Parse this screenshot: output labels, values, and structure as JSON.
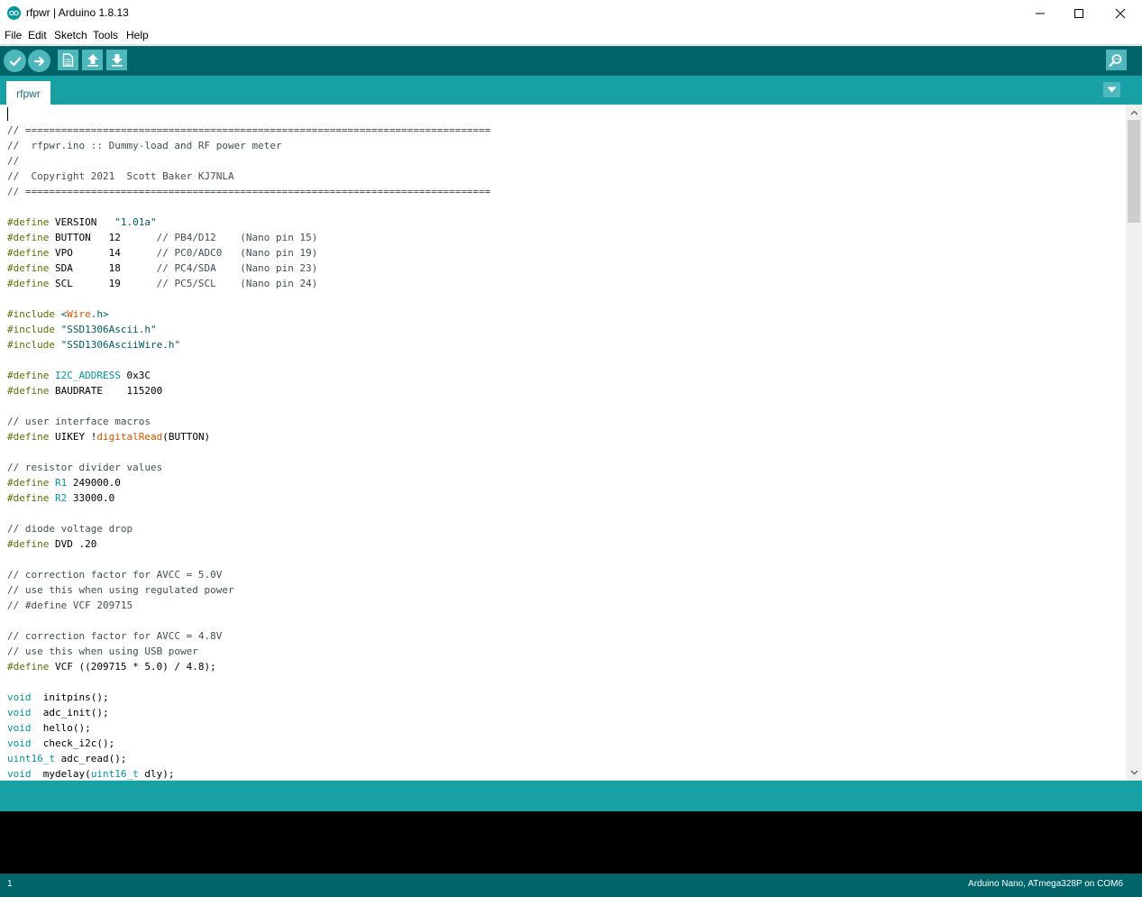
{
  "window": {
    "title": "rfpwr | Arduino 1.8.13"
  },
  "menu": [
    "File",
    "Edit",
    "Sketch",
    "Tools",
    "Help"
  ],
  "toolbar": {
    "buttons": [
      {
        "name": "verify",
        "icon": "check-icon"
      },
      {
        "name": "upload",
        "icon": "arrow-right-icon"
      },
      {
        "name": "new",
        "icon": "new-file-icon"
      },
      {
        "name": "open",
        "icon": "arrow-up-icon"
      },
      {
        "name": "save",
        "icon": "arrow-down-icon"
      },
      {
        "name": "serial-monitor",
        "icon": "magnifier-icon"
      }
    ]
  },
  "tabs": [
    {
      "label": "rfpwr",
      "active": true
    }
  ],
  "colors": {
    "toolbar_bg": "#006468",
    "tab_strip_bg": "#17a1a5",
    "button_bg": "#4db7bb",
    "comment": "#434f54",
    "preprocessor": "#5e6d03",
    "string": "#005c5f",
    "keyword": "#00979c",
    "function": "#d35400",
    "console_bg": "#000000"
  },
  "editor": {
    "lines": [
      [
        [
          "c",
          "// =============================================================================="
        ]
      ],
      [
        [
          "c",
          "//  rfpwr.ino :: Dummy-load and RF power meter"
        ]
      ],
      [
        [
          "c",
          "//"
        ]
      ],
      [
        [
          "c",
          "//  Copyright 2021  Scott Baker KJ7NLA"
        ]
      ],
      [
        [
          "c",
          "// =============================================================================="
        ]
      ],
      [],
      [
        [
          "p",
          "#define"
        ],
        [
          "",
          " VERSION   "
        ],
        [
          "s",
          "\"1.01a\""
        ]
      ],
      [
        [
          "p",
          "#define"
        ],
        [
          "",
          " BUTTON   12      "
        ],
        [
          "c",
          "// PB4/D12    (Nano pin 15)"
        ]
      ],
      [
        [
          "p",
          "#define"
        ],
        [
          "",
          " VPO      14      "
        ],
        [
          "c",
          "// PC0/ADC0   (Nano pin 19)"
        ]
      ],
      [
        [
          "p",
          "#define"
        ],
        [
          "",
          " SDA      18      "
        ],
        [
          "c",
          "// PC4/SDA    (Nano pin 23)"
        ]
      ],
      [
        [
          "p",
          "#define"
        ],
        [
          "",
          " SCL      19      "
        ],
        [
          "c",
          "// PC5/SCL    (Nano pin 24)"
        ]
      ],
      [],
      [
        [
          "p",
          "#include"
        ],
        [
          "",
          " "
        ],
        [
          "s",
          "<"
        ],
        [
          "f",
          "Wire"
        ],
        [
          "s",
          ".h>"
        ]
      ],
      [
        [
          "p",
          "#include"
        ],
        [
          "",
          " "
        ],
        [
          "s",
          "\"SSD1306Ascii.h\""
        ]
      ],
      [
        [
          "p",
          "#include"
        ],
        [
          "",
          " "
        ],
        [
          "s",
          "\"SSD1306AsciiWire.h\""
        ]
      ],
      [],
      [
        [
          "p",
          "#define"
        ],
        [
          "",
          " "
        ],
        [
          "k",
          "I2C_ADDRESS"
        ],
        [
          "",
          " 0x3C"
        ]
      ],
      [
        [
          "p",
          "#define"
        ],
        [
          "",
          " BAUDRATE    115200"
        ]
      ],
      [],
      [
        [
          "c",
          "// user interface macros"
        ]
      ],
      [
        [
          "p",
          "#define"
        ],
        [
          "",
          " UIKEY !"
        ],
        [
          "f",
          "digitalRead"
        ],
        [
          "",
          "(BUTTON)"
        ]
      ],
      [],
      [
        [
          "c",
          "// resistor divider values"
        ]
      ],
      [
        [
          "p",
          "#define"
        ],
        [
          "",
          " "
        ],
        [
          "k",
          "R1"
        ],
        [
          "",
          " 249000.0"
        ]
      ],
      [
        [
          "p",
          "#define"
        ],
        [
          "",
          " "
        ],
        [
          "k",
          "R2"
        ],
        [
          "",
          " 33000.0"
        ]
      ],
      [],
      [
        [
          "c",
          "// diode voltage drop"
        ]
      ],
      [
        [
          "p",
          "#define"
        ],
        [
          "",
          " DVD .20"
        ]
      ],
      [],
      [
        [
          "c",
          "// correction factor for AVCC = 5.0V"
        ]
      ],
      [
        [
          "c",
          "// use this when using regulated power"
        ]
      ],
      [
        [
          "c",
          "// #define VCF 209715"
        ]
      ],
      [],
      [
        [
          "c",
          "// correction factor for AVCC = 4.8V"
        ]
      ],
      [
        [
          "c",
          "// use this when using USB power"
        ]
      ],
      [
        [
          "p",
          "#define"
        ],
        [
          "",
          " VCF ((209715 * 5.0) / 4.8);"
        ]
      ],
      [],
      [
        [
          "k",
          "void"
        ],
        [
          "",
          "  initpins();"
        ]
      ],
      [
        [
          "k",
          "void"
        ],
        [
          "",
          "  adc_init();"
        ]
      ],
      [
        [
          "k",
          "void"
        ],
        [
          "",
          "  hello();"
        ]
      ],
      [
        [
          "k",
          "void"
        ],
        [
          "",
          "  check_i2c();"
        ]
      ],
      [
        [
          "k",
          "uint16_t"
        ],
        [
          "",
          " adc_read();"
        ]
      ],
      [
        [
          "k",
          "void"
        ],
        [
          "",
          "  mydelay("
        ],
        [
          "k",
          "uint16_t"
        ],
        [
          "",
          " dly);"
        ]
      ]
    ]
  },
  "status": {
    "line_number": "1",
    "board": "Arduino Nano, ATmega328P on COM6"
  }
}
